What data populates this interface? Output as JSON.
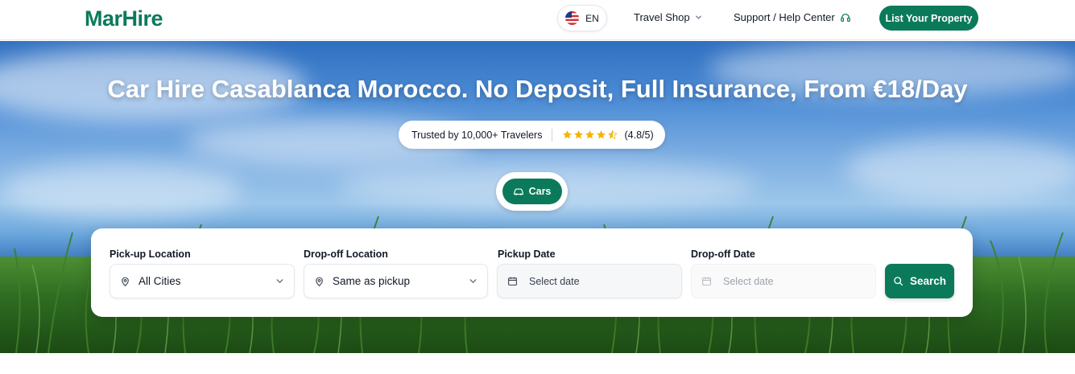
{
  "header": {
    "logo_text": "MarHire",
    "language": {
      "code": "EN",
      "flag_icon": "us-flag-icon"
    },
    "nav": [
      {
        "label": "Travel Shop",
        "icon": "chevron-down-icon"
      },
      {
        "label": "Support / Help Center",
        "icon": "headset-icon"
      }
    ],
    "cta_label": "List Your Property"
  },
  "hero": {
    "title": "Car Hire Casablanca Morocco. No Deposit, Full Insurance, From €18/Day",
    "trust": {
      "text": "Trusted by 10,000+ Travelers",
      "rating": 4.8,
      "rating_max": 5,
      "rating_text": "(4.8/5)"
    },
    "category_tab": {
      "label": "Cars",
      "icon": "car-icon"
    }
  },
  "search": {
    "pickup_location": {
      "label": "Pick-up Location",
      "value": "All Cities",
      "icon": "map-pin-icon"
    },
    "dropoff_location": {
      "label": "Drop-off Location",
      "value": "Same as pickup",
      "icon": "map-pin-icon"
    },
    "pickup_date": {
      "label": "Pickup Date",
      "placeholder": "Select date",
      "icon": "calendar-icon"
    },
    "dropoff_date": {
      "label": "Drop-off Date",
      "placeholder": "Select date",
      "icon": "calendar-icon"
    },
    "button_label": "Search"
  },
  "colors": {
    "brand": "#0b7a5a",
    "star": "#f5b400"
  }
}
